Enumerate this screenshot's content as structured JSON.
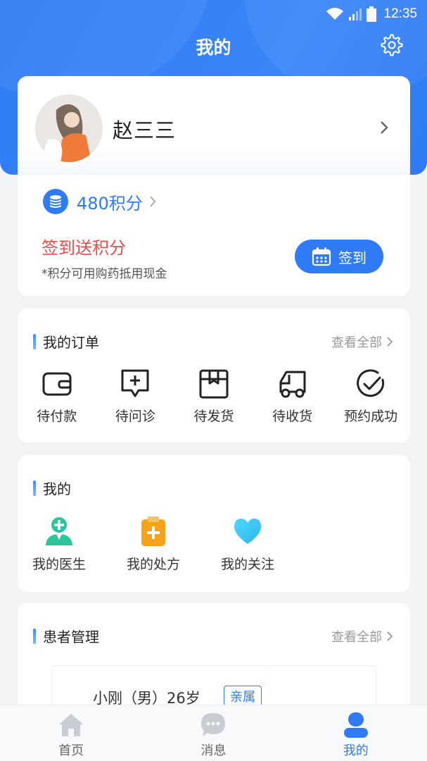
{
  "status_bar": {
    "time": "12:35"
  },
  "header": {
    "title": "我的"
  },
  "profile": {
    "name": "赵三三"
  },
  "points": {
    "label": "480积分",
    "signin_title": "签到送积分",
    "signin_subtitle": "*积分可用购药抵用现金",
    "signin_button": "签到"
  },
  "orders": {
    "title": "我的订单",
    "view_all": "查看全部",
    "items": [
      {
        "label": "待付款",
        "icon": "wallet-icon"
      },
      {
        "label": "待问诊",
        "icon": "consult-icon"
      },
      {
        "label": "待发货",
        "icon": "package-icon"
      },
      {
        "label": "待收货",
        "icon": "truck-icon"
      },
      {
        "label": "预约成功",
        "icon": "check-circle-icon"
      }
    ]
  },
  "mine": {
    "title": "我的",
    "items": [
      {
        "label": "我的医生",
        "icon": "doctor-icon"
      },
      {
        "label": "我的处方",
        "icon": "prescription-icon"
      },
      {
        "label": "我的关注",
        "icon": "heart-icon"
      }
    ]
  },
  "patients": {
    "title": "患者管理",
    "view_all": "查看全部",
    "items": [
      {
        "text": "小刚（男）26岁",
        "relation": "亲属"
      }
    ]
  },
  "tabs": [
    {
      "label": "首页",
      "icon": "home-icon",
      "active": false
    },
    {
      "label": "消息",
      "icon": "message-icon",
      "active": false
    },
    {
      "label": "我的",
      "icon": "user-icon",
      "active": true
    }
  ],
  "colors": {
    "primary": "#2f7bf5",
    "signin_red": "#ef4b4b",
    "doctor_green": "#2cc59a",
    "prescription_orange": "#f7a21b",
    "heart_cyan": "#3fc9f5"
  }
}
